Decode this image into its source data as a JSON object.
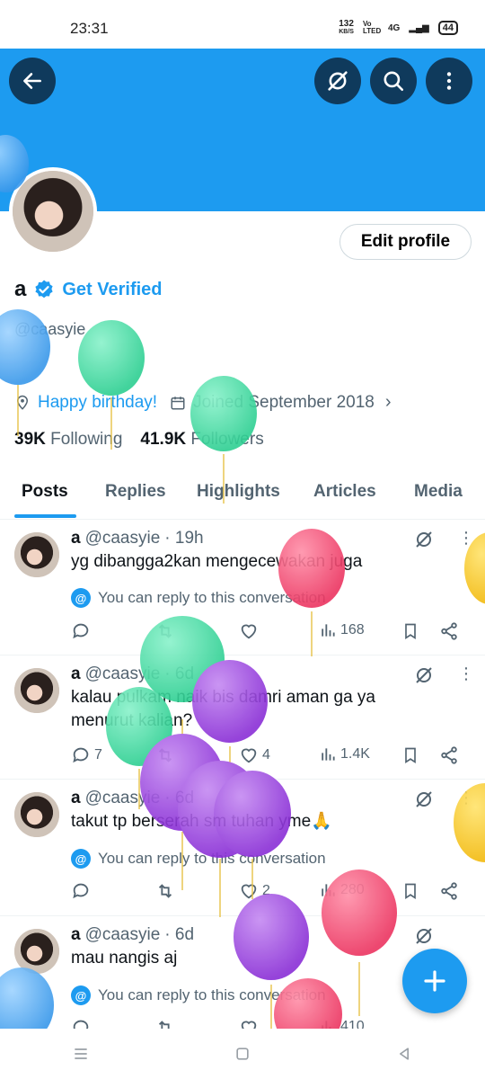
{
  "status_bar": {
    "time": "23:31",
    "speed_value": "132",
    "speed_unit": "KB/S",
    "volte": "Vo LTED",
    "network": "4G",
    "battery": "44"
  },
  "profile": {
    "display_name": "a",
    "get_verified": "Get Verified",
    "handle": "@caasyie",
    "link": "Happy birthday!",
    "joined": "Joined September 2018",
    "following_count": "39K",
    "following_label": "Following",
    "followers_count": "41.9K",
    "followers_label": "Followers",
    "edit_profile_label": "Edit profile"
  },
  "tabs": [
    {
      "label": "Posts"
    },
    {
      "label": "Replies"
    },
    {
      "label": "Highlights"
    },
    {
      "label": "Articles"
    },
    {
      "label": "Media"
    }
  ],
  "posts": [
    {
      "name": "a",
      "handle": "@caasyie",
      "time": "· 19h",
      "text": "yg dibangga2kan mengecewakan juga",
      "reply_info": "You can reply to this conversation",
      "replies": "",
      "reposts": "",
      "likes": "",
      "views": "168"
    },
    {
      "name": "a",
      "handle": "@caasyie",
      "time": "· 6d",
      "text": "kalau pulkam naik bis damri aman ga ya menurut kalian?",
      "reply_info": "",
      "replies": "7",
      "reposts": "",
      "likes": "4",
      "views": "1.4K"
    },
    {
      "name": "a",
      "handle": "@caasyie",
      "time": "· 6d",
      "text": "takut tp berserah sm tuhan yme🙏",
      "reply_info": "You can reply to this conversation",
      "replies": "",
      "reposts": "",
      "likes": "2",
      "views": "280"
    },
    {
      "name": "a",
      "handle": "@caasyie",
      "time": "· 6d",
      "text": "mau nangis aj",
      "reply_info": "You can reply to this conversation",
      "replies": "",
      "reposts": "",
      "likes": "",
      "views": "410"
    }
  ],
  "colors": {
    "accent": "#1d9bf0",
    "balloon_green": "#3ddca0",
    "balloon_purple": "#9b3be0",
    "balloon_pink": "#f0456b",
    "balloon_blue": "#4aa8f0",
    "balloon_yellow": "#f5c518"
  },
  "icons": {
    "back": "arrow-left-icon",
    "grok": "grok-icon",
    "search": "search-icon",
    "more": "more-vertical-icon",
    "compose": "plus-icon"
  }
}
